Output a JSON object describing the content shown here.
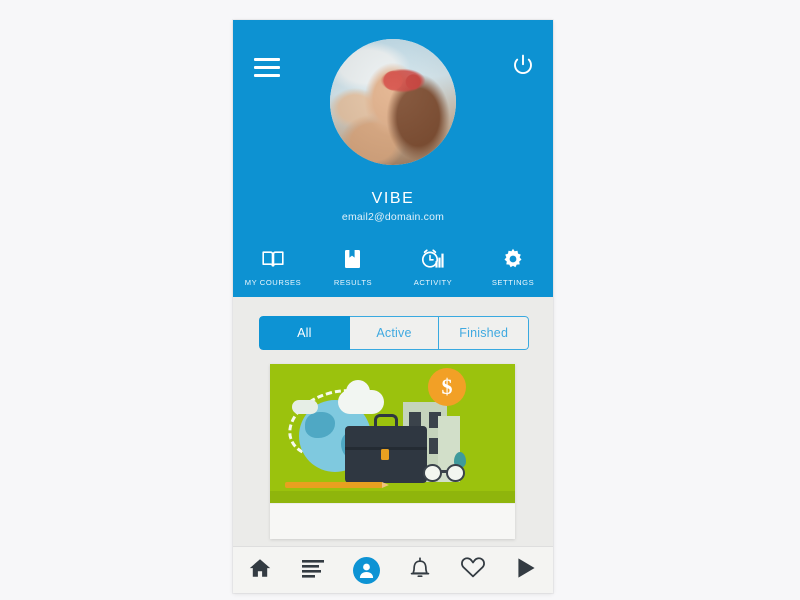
{
  "app": {
    "header_color": "#0d92d2",
    "accent_color": "#0d93d4",
    "background_color": "#f7f7f9",
    "screen_background": "#ebebe9"
  },
  "header": {
    "menu_icon": "hamburger-menu-icon",
    "power_icon": "power-icon",
    "avatar_alt": "user-avatar-photo",
    "profile_name": "VIBE",
    "profile_email": "email2@domain.com",
    "tabs": [
      {
        "label": "MY COURSES",
        "icon": "open-book-icon",
        "active": true
      },
      {
        "label": "RESULTS",
        "icon": "bookmark-book-icon",
        "active": false
      },
      {
        "label": "ACTIVITY",
        "icon": "alarm-clock-chart-icon",
        "active": false
      },
      {
        "label": "SETTINGS",
        "icon": "gear-icon",
        "active": false
      }
    ]
  },
  "filters": {
    "options": [
      {
        "label": "All",
        "active": true
      },
      {
        "label": "Active",
        "active": false
      },
      {
        "label": "Finished",
        "active": false
      }
    ]
  },
  "course_card": {
    "banner_color": "#9bc20d",
    "illustration": "business-globe-briefcase-illustration",
    "coin_symbol": "$"
  },
  "bottom_nav": {
    "items": [
      {
        "icon": "home-icon",
        "active": false
      },
      {
        "icon": "list-lines-icon",
        "active": false
      },
      {
        "icon": "profile-person-icon",
        "active": true
      },
      {
        "icon": "bell-notification-icon",
        "active": false
      },
      {
        "icon": "heart-favorite-icon",
        "active": false
      },
      {
        "icon": "play-triangle-icon",
        "active": false
      }
    ]
  }
}
